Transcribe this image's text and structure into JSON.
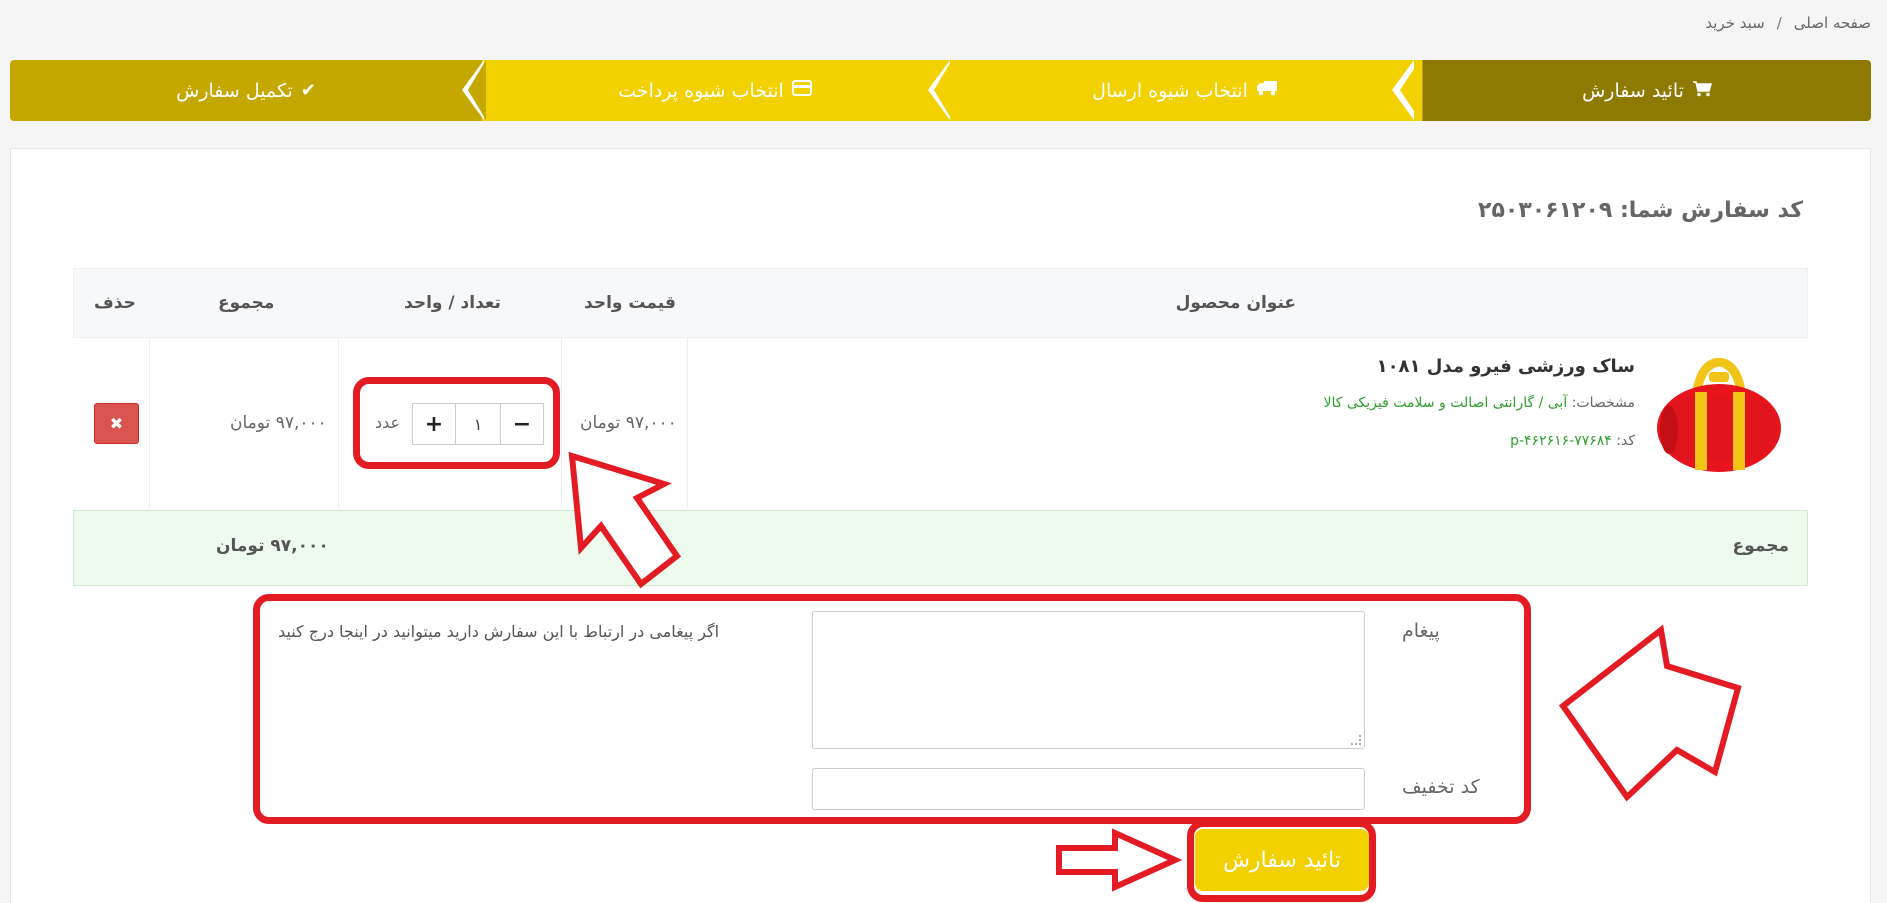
{
  "breadcrumb": {
    "home": "صفحه اصلی",
    "separator": "/",
    "current": "سبد خرید"
  },
  "steps": [
    {
      "label": "تائید سفارش",
      "icon": "cart-icon"
    },
    {
      "label": "انتخاب شیوه ارسال",
      "icon": "truck-icon"
    },
    {
      "label": "انتخاب شیوه پرداخت",
      "icon": "credit-card-icon"
    },
    {
      "label": "تکمیل سفارش",
      "icon": "check-icon"
    }
  ],
  "order": {
    "code_label": "کد سفارش شما: ۲۵۰۳۰۶۱۲۰۹"
  },
  "table": {
    "headers": {
      "product": "عنوان محصول",
      "unit_price": "قیمت واحد",
      "qty": "تعداد / واحد",
      "total": "مجموع",
      "delete": "حذف"
    },
    "rows": [
      {
        "title": "ساک ورزشی فیرو مدل ۱۰۸۱",
        "spec_label": "مشخصات:",
        "spec_value": "آبی / گارانتی اصالت و سلامت فیزیکی کالا",
        "code_label": "کد:",
        "code_value": "p-۴۶۲۶۱۶-۷۷۶۸۴",
        "unit_price": "۹۷,۰۰۰ تومان",
        "qty": "۱",
        "unit": "عدد",
        "total": "۹۷,۰۰۰ تومان"
      }
    ],
    "sum_label": "مجموع",
    "sum_value": "۹۷,۰۰۰ تومان"
  },
  "form": {
    "message_label": "پیغام",
    "message_hint": "اگر پیغامی در ارتباط با این سفارش دارید میتوانید در اینجا درج کنید",
    "discount_label": "کد تخفیف",
    "confirm_label": "تائید سفارش"
  },
  "colors": {
    "step_dark": "#8e7a02",
    "step_yellow": "#f3d000",
    "step_mid": "#c4a800",
    "delete_red": "#d9534f",
    "annotation_red": "#e31b23",
    "green_text": "#2e9e2e"
  }
}
